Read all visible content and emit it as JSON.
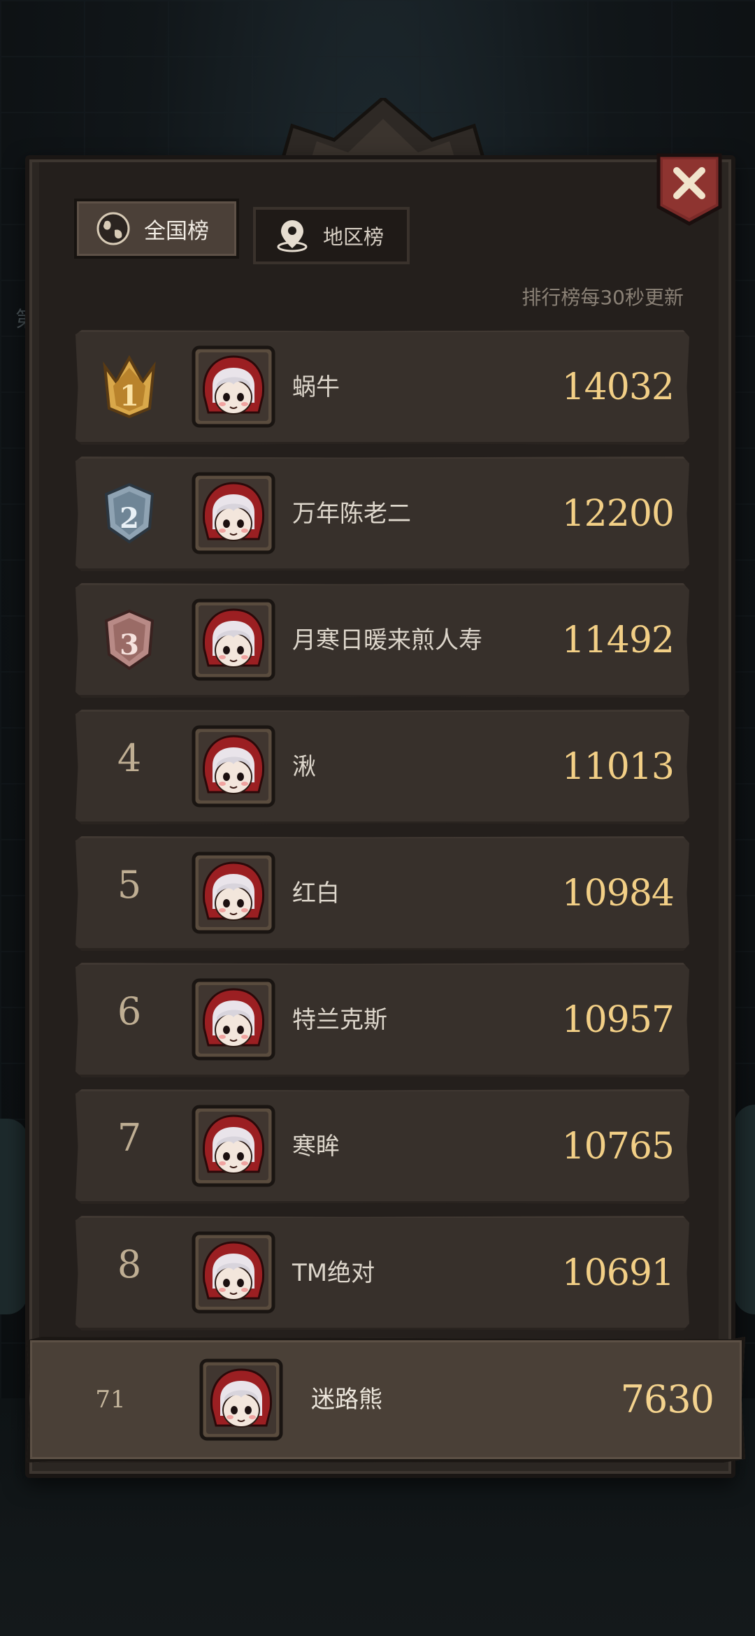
{
  "tabs": [
    {
      "label": "全国榜",
      "icon": "globe-icon",
      "selected": true
    },
    {
      "label": "地区榜",
      "icon": "location-pin-icon",
      "selected": false
    }
  ],
  "refresh_note": "排行榜每30秒更新",
  "side_glyph": "第",
  "leaderboard": [
    {
      "rank": "1",
      "name": "蜗牛",
      "score": "14032",
      "badge": "gold-crown-badge"
    },
    {
      "rank": "2",
      "name": "万年陈老二",
      "score": "12200",
      "badge": "silver-shield-badge"
    },
    {
      "rank": "3",
      "name": "月寒日暖来煎人寿",
      "score": "11492",
      "badge": "bronze-shield-badge"
    },
    {
      "rank": "4",
      "name": "湫",
      "score": "11013"
    },
    {
      "rank": "5",
      "name": "红白",
      "score": "10984"
    },
    {
      "rank": "6",
      "name": "特兰克斯",
      "score": "10957"
    },
    {
      "rank": "7",
      "name": "寒眸",
      "score": "10765"
    },
    {
      "rank": "8",
      "name": "TM绝对",
      "score": "10691"
    }
  ],
  "my_entry": {
    "rank": "71",
    "name": "迷路熊",
    "score": "7630"
  },
  "colors": {
    "gold": "#d9a84a",
    "silver": "#8fa3b3",
    "bronze": "#b88a86",
    "score": "#f2cf86"
  }
}
